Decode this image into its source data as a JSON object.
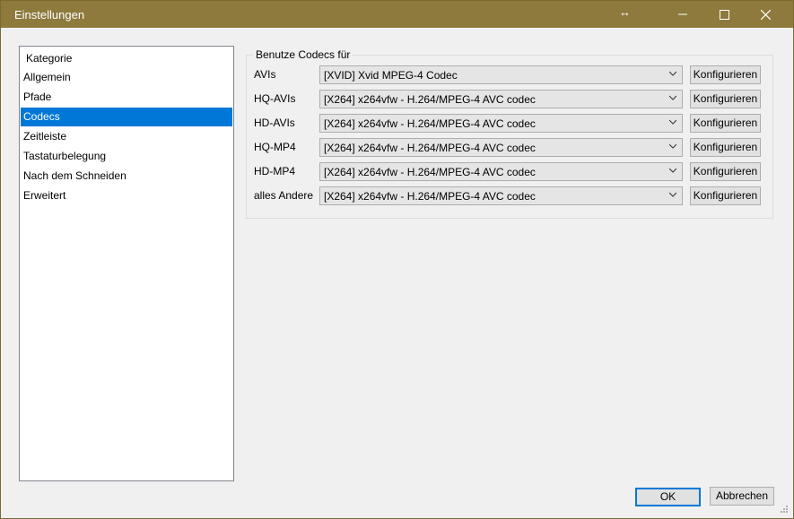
{
  "window": {
    "title": "Einstellungen",
    "resize_cursor_glyph": "↔"
  },
  "category_list": {
    "header": "Kategorie",
    "items": [
      {
        "label": "Allgemein"
      },
      {
        "label": "Pfade"
      },
      {
        "label": "Codecs",
        "selected": true
      },
      {
        "label": "Zeitleiste"
      },
      {
        "label": "Tastaturbelegung"
      },
      {
        "label": "Nach dem Schneiden"
      },
      {
        "label": "Erweitert"
      }
    ]
  },
  "codecs": {
    "group_title": "Benutze Codecs für",
    "configure_label": "Konfigurieren",
    "rows": [
      {
        "label": "AVIs",
        "value": "[XVID] Xvid MPEG-4 Codec"
      },
      {
        "label": "HQ-AVIs",
        "value": "[X264] x264vfw - H.264/MPEG-4 AVC codec"
      },
      {
        "label": "HD-AVIs",
        "value": "[X264] x264vfw - H.264/MPEG-4 AVC codec"
      },
      {
        "label": "HQ-MP4",
        "value": "[X264] x264vfw - H.264/MPEG-4 AVC codec"
      },
      {
        "label": "HD-MP4",
        "value": "[X264] x264vfw - H.264/MPEG-4 AVC codec"
      },
      {
        "label": "alles Andere",
        "value": "[X264] x264vfw - H.264/MPEG-4 AVC codec"
      }
    ]
  },
  "buttons": {
    "ok": "OK",
    "cancel": "Abbrechen"
  },
  "colors": {
    "titlebar": "#8d7a3c",
    "selection": "#0078d7"
  }
}
